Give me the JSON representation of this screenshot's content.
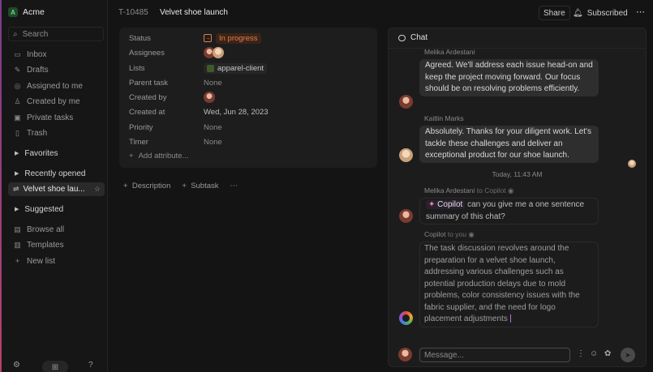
{
  "sidebar": {
    "workspace": {
      "initial": "A",
      "name": "Acme"
    },
    "search_label": "Search",
    "nav": [
      {
        "label": "Inbox",
        "icon": "inbox-icon"
      },
      {
        "label": "Drafts",
        "icon": "pencil-icon"
      },
      {
        "label": "Assigned to me",
        "icon": "target-icon"
      },
      {
        "label": "Created by me",
        "icon": "person-icon"
      },
      {
        "label": "Private tasks",
        "icon": "lock-icon"
      },
      {
        "label": "Trash",
        "icon": "trash-icon"
      }
    ],
    "favorites": "Favorites",
    "recently_opened": "Recently opened",
    "active_item": "Velvet shoe lau...",
    "suggested": "Suggested",
    "browse_all": "Browse all",
    "templates": "Templates",
    "new_list": "New list"
  },
  "topbar": {
    "task_id": "T-10485",
    "title": "Velvet shoe launch",
    "share": "Share",
    "subscribed": "Subscribed"
  },
  "properties": {
    "status_label": "Status",
    "status_value": "In progress",
    "assignees_label": "Assignees",
    "lists_label": "Lists",
    "lists_value": "apparel-client",
    "parent_label": "Parent task",
    "parent_value": "None",
    "created_by_label": "Created by",
    "created_at_label": "Created at",
    "created_at_value": "Wed, Jun 28, 2023",
    "priority_label": "Priority",
    "priority_value": "None",
    "timer_label": "Timer",
    "timer_value": "None",
    "add_attribute": "Add attribute..."
  },
  "subactions": {
    "description": "Description",
    "subtask": "Subtask"
  },
  "chat": {
    "title": "Chat",
    "messages": [
      {
        "author": "Melika Ardestani",
        "text": "Agreed. We'll address each issue head-on and keep the project moving forward. Our focus should be on resolving problems efficiently."
      },
      {
        "author": "Kaitlin Marks",
        "text": "Absolutely. Thanks for your diligent work. Let's tackle these challenges and deliver an exceptional product for our shoe launch."
      },
      {
        "author": "Melika Ardestani",
        "to": "to Copilot",
        "tag": "Copilot",
        "text": "can you give me a one sentence summary of this chat?"
      },
      {
        "author": "Copilot",
        "to": "to you",
        "text": "The task discussion revolves around the preparation for a velvet shoe launch, addressing various challenges such as potential production delays due to mold problems, color consistency issues with the fabric supplier, and the need for logo placement adjustments"
      }
    ],
    "timestamp": "Today, 11:43 AM",
    "input_placeholder": "Message..."
  },
  "colors": {
    "status_accent": "#e57c4c",
    "background": "#141414",
    "panel": "#1c1c1c"
  }
}
